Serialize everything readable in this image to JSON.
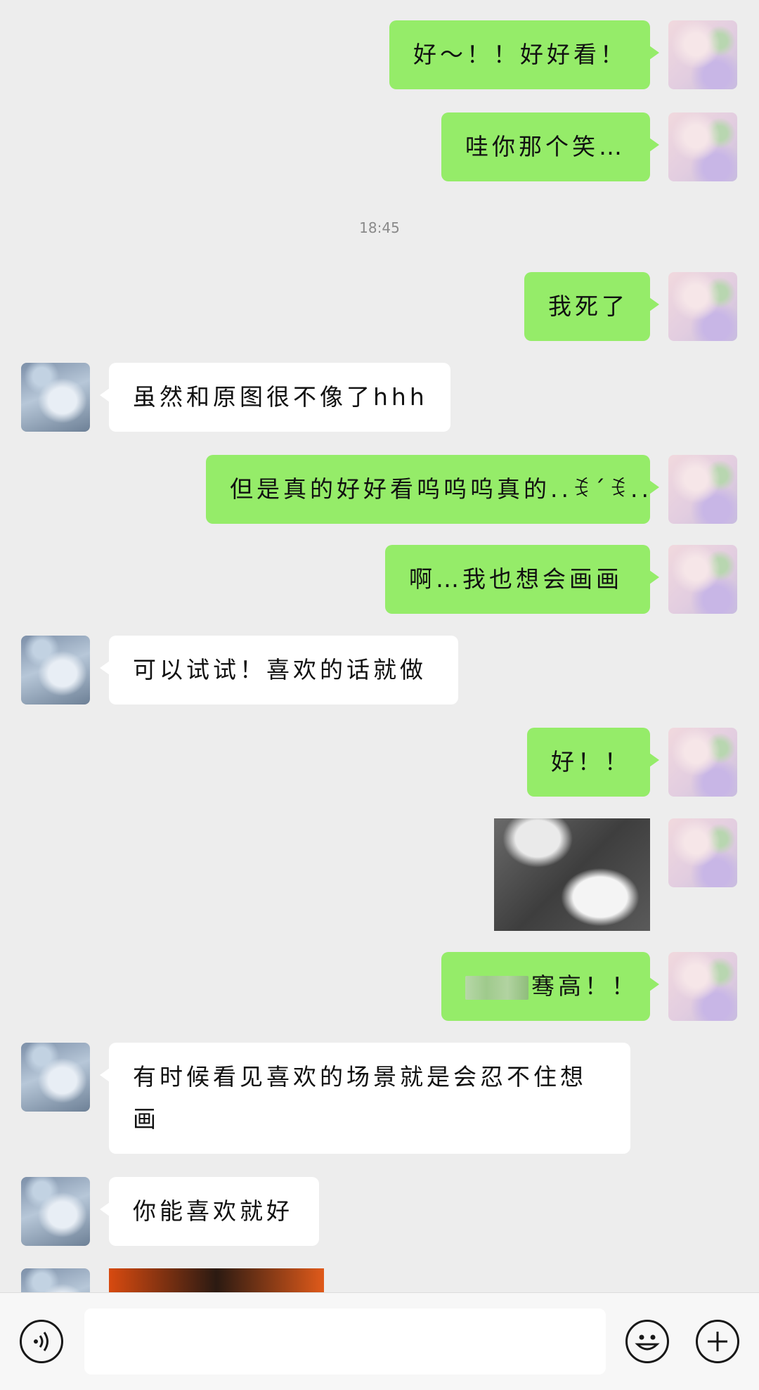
{
  "timestamp": "18:45",
  "messages": [
    {
      "side": "out",
      "text": "好～！！好好看！"
    },
    {
      "side": "out",
      "text": "哇你那个笑…"
    },
    {
      "side": "out",
      "text": "我死了"
    },
    {
      "side": "in",
      "text": "虽然和原图很不像了hhh"
    },
    {
      "side": "out",
      "text": "但是真的好好看呜呜呜真的..ꉂ´ꉂ.."
    },
    {
      "side": "out",
      "text": "啊…我也想会画画"
    },
    {
      "side": "in",
      "text": "可以试试！喜欢的话就做"
    },
    {
      "side": "out",
      "text": "好！！"
    },
    {
      "side": "out",
      "text": "[图片]"
    },
    {
      "side": "out",
      "text": "骞高！！"
    },
    {
      "side": "in",
      "text": "有时候看见喜欢的场景就是会忍不住想画"
    },
    {
      "side": "in",
      "text": "你能喜欢就好"
    },
    {
      "side": "in",
      "text": "[图片]"
    }
  ],
  "input": {
    "placeholder": ""
  },
  "icons": {
    "voice": "voice-icon",
    "emoji": "emoji-icon",
    "plus": "plus-icon"
  }
}
